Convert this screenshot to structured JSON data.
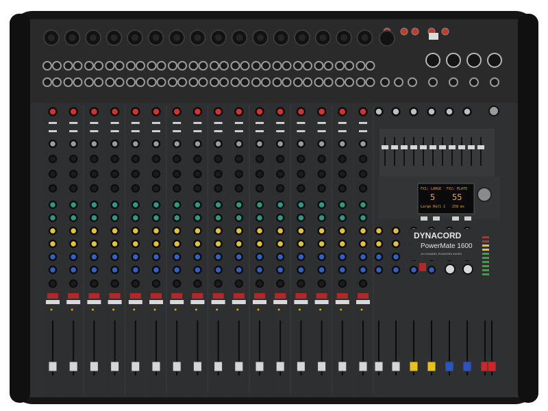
{
  "product": {
    "brand": "DYNACORD",
    "model": "PowerMate 1600",
    "subtitle": "16 CHANNEL POWERED MIXER"
  },
  "display": {
    "row1_left_label": "FX1: LARGE",
    "row1_right_label": "FX2: PLATE",
    "preset_left": "5",
    "preset_right": "55",
    "name_left": "Large Hall 1",
    "name_right": "258 ms"
  },
  "colors": {
    "chassis": "#1b1b1b",
    "panel": "#2e2f31",
    "gain_knob": "#d2332f",
    "eq_knob_green": "#2a9c86",
    "aux_knob_yellow": "#e3c23a",
    "fx_knob_blue": "#2f62c4",
    "fader_cap": "#d6d6d6",
    "fader_cap_yellow": "#e6c21c",
    "fader_cap_blue": "#2a54c2",
    "fader_cap_red": "#d0252a",
    "oled_bg": "#0a0a0a",
    "oled_text": "#f0a020"
  },
  "icons": {
    "xlr_input": "xlr-socket-icon",
    "jack_input": "jack-socket-icon",
    "knob": "rotary-knob-icon",
    "fader": "slider-fader-icon",
    "selector": "push-knob-icon"
  }
}
